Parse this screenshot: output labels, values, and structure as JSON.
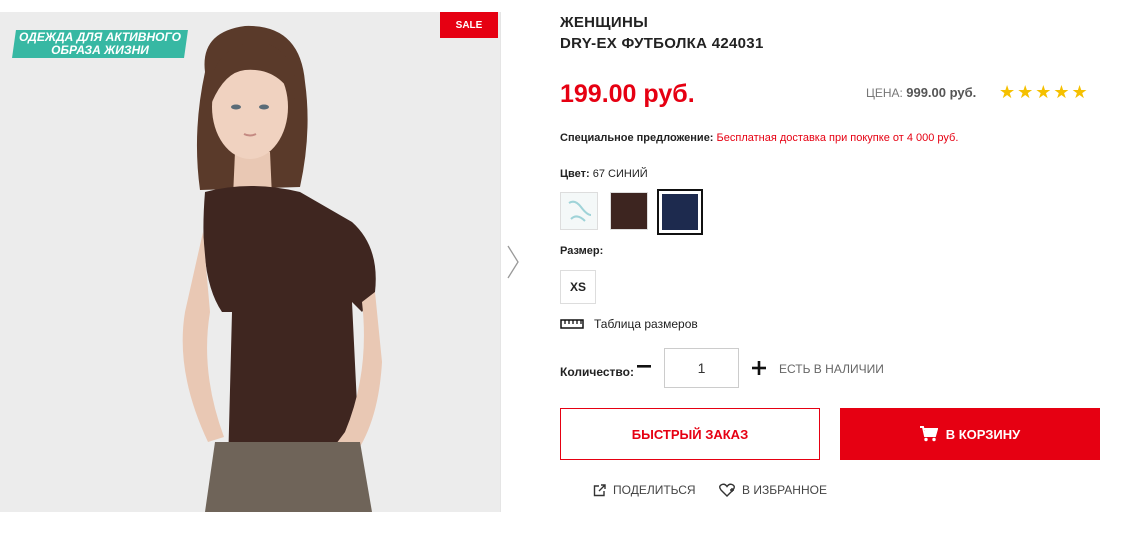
{
  "product": {
    "category": "ЖЕНЩИНЫ",
    "title": "DRY-EX ФУТБОЛКА 424031",
    "price": "199.00 руб.",
    "old_price_label": "ЦЕНА:",
    "old_price_value": "999.00 руб.",
    "rating_stars": "★★★★★",
    "rating": 5
  },
  "photo": {
    "promo_line1": "ОДЕЖДА ДЛЯ АКТИВНОГО",
    "promo_line2": "ОБРАЗА ЖИЗНИ",
    "sale_badge": "SALE",
    "icon_next": "chevron-right-icon"
  },
  "special_offer": {
    "label": "Специальное предложение:",
    "value": "Бесплатная доставка при покупке от 4 000 руб."
  },
  "color": {
    "label": "Цвет:",
    "selected": "67 СИНИЙ",
    "swatches": [
      {
        "name": "white-print",
        "color": "#f4f8f8"
      },
      {
        "name": "brown",
        "color": "#3d2520"
      },
      {
        "name": "navy",
        "color": "#1d2a4e",
        "selected": true
      }
    ]
  },
  "size": {
    "label": "Размер:",
    "options": [
      "XS"
    ],
    "table_link": "Таблица размеров",
    "table_icon": "ruler-icon"
  },
  "quantity": {
    "label": "Количество:",
    "value": "1",
    "stock_status": "ЕСТЬ В НАЛИЧИИ"
  },
  "buttons": {
    "quick_order": "БЫСТРЫЙ ЗАКАЗ",
    "add_to_cart": "В КОРЗИНУ",
    "cart_icon": "cart-icon"
  },
  "actions": {
    "share": "ПОДЕЛИТЬСЯ",
    "share_icon": "share-icon",
    "favorite": "В ИЗБРАННОЕ",
    "favorite_icon": "heart-plus-icon"
  },
  "colors": {
    "accent": "#e60012",
    "promo": "#37b8a3",
    "stars": "#f5c000"
  }
}
